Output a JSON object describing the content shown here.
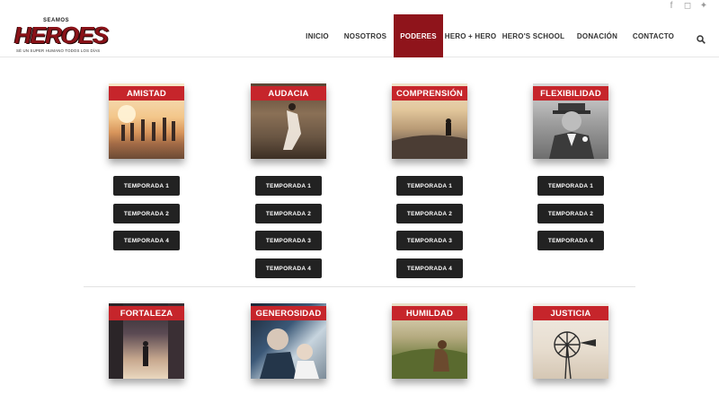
{
  "header": {
    "logo": {
      "top_text": "SEAMOS",
      "main_text": "HEROES",
      "tagline": "SÉ UN SUPER HUMANO TODOS LOS DÍAS"
    },
    "nav": [
      {
        "label": "INICIO",
        "active": false
      },
      {
        "label": "NOSOTROS",
        "active": false
      },
      {
        "label": "PODERES",
        "active": true
      },
      {
        "label": "HERO + HERO",
        "active": false
      },
      {
        "label": "HERO'S SCHOOL",
        "active": false
      },
      {
        "label": "DONACIÓN",
        "active": false
      },
      {
        "label": "CONTACTO",
        "active": false
      }
    ],
    "social": [
      "facebook-icon",
      "instagram-icon",
      "twitter-icon"
    ],
    "search_icon": "search-icon"
  },
  "powers": [
    {
      "label": "AMISTAD",
      "buttons": [
        "TEMPORADA 1",
        "TEMPORADA 2",
        "TEMPORADA 4"
      ]
    },
    {
      "label": "AUDACIA",
      "buttons": [
        "TEMPORADA 1",
        "TEMPORADA 2",
        "TEMPORADA 3",
        "TEMPORADA 4"
      ]
    },
    {
      "label": "COMPRENSIÓN",
      "buttons": [
        "TEMPORADA 1",
        "TEMPORADA 2",
        "TEMPORADA 3",
        "TEMPORADA 4"
      ]
    },
    {
      "label": "FLEXIBILIDAD",
      "buttons": [
        "TEMPORADA 1",
        "TEMPORADA 2",
        "TEMPORADA 4"
      ]
    },
    {
      "label": "FORTALEZA",
      "buttons": []
    },
    {
      "label": "GENEROSIDAD",
      "buttons": []
    },
    {
      "label": "HUMILDAD",
      "buttons": []
    },
    {
      "label": "JUSTICIA",
      "buttons": []
    }
  ],
  "colors": {
    "accent": "#8f141b",
    "label_red": "#c6252b",
    "button_dark": "#222222"
  }
}
